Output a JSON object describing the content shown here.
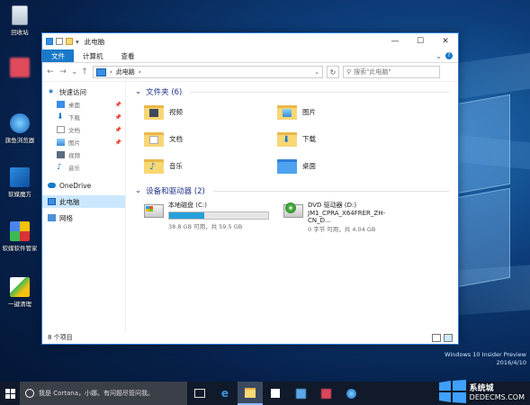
{
  "desktop": {
    "icons": [
      {
        "label": "回收站"
      },
      {
        "label": ""
      },
      {
        "label": "旗鱼浏览器"
      },
      {
        "label": "软媒魔方"
      },
      {
        "label": "软媒软件管家"
      },
      {
        "label": "一键清理"
      }
    ],
    "osinfo": {
      "line1": "Windows 10 Insider Preview",
      "line2": "2016/4/10"
    }
  },
  "window": {
    "title": "此电脑",
    "ribbon_tabs": [
      "文件",
      "计算机",
      "查看"
    ],
    "address": {
      "location": "此电脑",
      "separator": "›"
    },
    "search_placeholder": "搜索\"此电脑\"",
    "nav_pane": [
      {
        "label": "快速访问",
        "type": "header"
      },
      {
        "label": "桌面",
        "type": "pinned"
      },
      {
        "label": "下载",
        "type": "pinned"
      },
      {
        "label": "文档",
        "type": "pinned"
      },
      {
        "label": "图片",
        "type": "pinned"
      },
      {
        "label": "视频",
        "type": "sub"
      },
      {
        "label": "音乐",
        "type": "sub"
      },
      {
        "label": "OneDrive",
        "type": "header"
      },
      {
        "label": "此电脑",
        "type": "selected"
      },
      {
        "label": "网络",
        "type": "header"
      }
    ],
    "folders_group": "文件夹 (6)",
    "folders": [
      {
        "name": "视频",
        "emblem": "video"
      },
      {
        "name": "图片",
        "emblem": "picture"
      },
      {
        "name": "文档",
        "emblem": "document"
      },
      {
        "name": "下载",
        "emblem": "download"
      },
      {
        "name": "音乐",
        "emblem": "music"
      },
      {
        "name": "桌面",
        "emblem": "desktop"
      }
    ],
    "drives_group": "设备和驱动器 (2)",
    "drives": [
      {
        "name": "本地磁盘 (C:)",
        "free_text": "38.8 GB 可用，共 59.5 GB",
        "used_fraction": 0.35,
        "icon": "hdd"
      },
      {
        "name": "DVD 驱动器 (D:)",
        "label2": "JM1_CPRA_X64FRER_ZH-CN_D...",
        "free_text": "0 字节 可用，共 4.04 GB",
        "icon": "dvd"
      }
    ],
    "status": "8 个项目"
  },
  "taskbar": {
    "search_text": "我是 Cortana，小娜。有问题尽管问我。",
    "icons": [
      "task-view-icon",
      "edge-icon",
      "explorer-icon",
      "store-icon",
      "app-icon",
      "app-icon-2",
      "browser-icon"
    ]
  },
  "watermark": {
    "main": "系统城",
    "sub": "DEDECMS.COM"
  },
  "colors": {
    "accent": "#1979ca",
    "selection": "#cce8ff",
    "folder": "#f8d775"
  }
}
